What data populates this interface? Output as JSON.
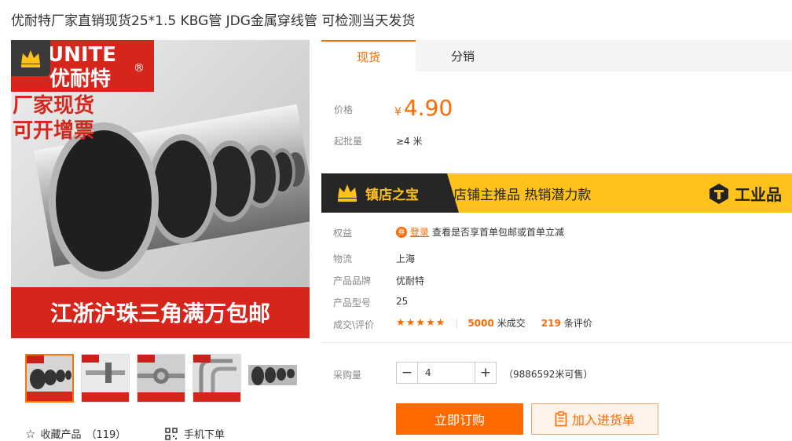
{
  "title": "优耐特厂家直销现货25*1.5 KBG管 JDG金属穿线管 可检测当天发货",
  "main_image": {
    "brand_text": "UNITE",
    "brand_cn": "优耐特",
    "reg_mark": "®",
    "promo_line1": "厂家现货",
    "promo_line2": "可开增票",
    "bottom_banner": "江浙沪珠三角满万包邮"
  },
  "thumbnails": [
    {
      "caption": "江浙沪珠三角满万包邮"
    },
    {
      "caption": "江浙沪珠三角满万包邮"
    },
    {
      "caption": "江浙沪珠三角满万包邮"
    },
    {
      "caption": "江浙沪珠三角满万包邮"
    },
    {
      "caption": ""
    }
  ],
  "actions": {
    "favorite_label": "收藏产品",
    "favorite_count": "（119）",
    "mobile_order": "手机下单"
  },
  "tabs": [
    {
      "label": "现货",
      "active": true
    },
    {
      "label": "分销",
      "active": false
    }
  ],
  "price": {
    "label": "价格",
    "currency": "¥",
    "value": "4.90",
    "moq_label": "起批量",
    "moq_value": "≥4 米"
  },
  "treasure": {
    "title": "镇店之宝",
    "text": "店铺主推品  热销潜力款",
    "right_text": "工业品"
  },
  "info": {
    "rights_label": "权益",
    "login_link": "登录",
    "rights_text": "查看是否享首单包邮或首单立减",
    "logistics_label": "物流",
    "logistics_value": "上海",
    "brand_label": "产品品牌",
    "brand_value": "优耐特",
    "model_label": "产品型号",
    "model_value": "25",
    "deal_label": "成交\\评价",
    "stars": "★★★★★",
    "sold_count": "5000",
    "sold_unit": "米成交",
    "review_count": "219",
    "review_unit": "条评价"
  },
  "quantity": {
    "label": "采购量",
    "minus": "−",
    "plus": "+",
    "value": "4",
    "available": "（9886592米可售）"
  },
  "buttons": {
    "buy_now": "立即订购",
    "add_cart": "加入进货单"
  },
  "colors": {
    "accent": "#ff6a00",
    "banner_yellow": "#ffc21a",
    "promo_red": "#d6261c"
  }
}
